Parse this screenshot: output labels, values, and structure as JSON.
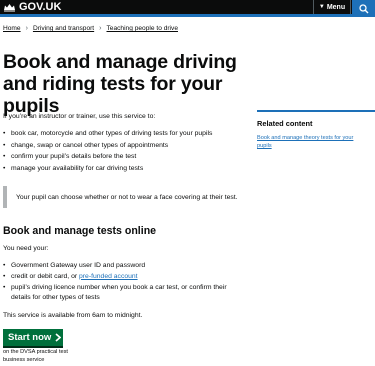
{
  "header": {
    "logo_text": "GOV.UK",
    "menu_label": "Menu",
    "icons": {
      "logo": "crown-icon",
      "menu": "chevron-down-icon",
      "search": "search-icon"
    },
    "colors": {
      "bar": "#0b0c0c",
      "accent": "#1d70b8"
    }
  },
  "breadcrumb": {
    "items": [
      "Home",
      "Driving and transport",
      "Teaching people to drive"
    ]
  },
  "page": {
    "title": "Book and manage driving and riding tests for your pupils",
    "intro": "If you’re an instructor or trainer, use this service to:",
    "service_items": [
      "book car, motorcycle and other types of driving tests for your pupils",
      "change, swap or cancel other types of appointments",
      "confirm your pupil’s details before the test",
      "manage your availability for car driving tests"
    ],
    "inset_text": "Your pupil can choose whether or not to wear a face covering at their test."
  },
  "section": {
    "heading": "Book and manage tests online",
    "need_text": "You need your:",
    "item1": "Government Gateway user ID and password",
    "item2_prefix": "credit or debit card, or ",
    "item2_link": "pre-funded account",
    "item3": "pupil’s driving licence number when you book a car test, or confirm their details for other types of tests",
    "availability": "This service is available from 6am to midnight."
  },
  "start": {
    "label": "Start now",
    "caption": "on the DVSA practical test business service",
    "color": "#00703c"
  },
  "related": {
    "title": "Related content",
    "link": "Book and manage theory tests for your pupils"
  }
}
